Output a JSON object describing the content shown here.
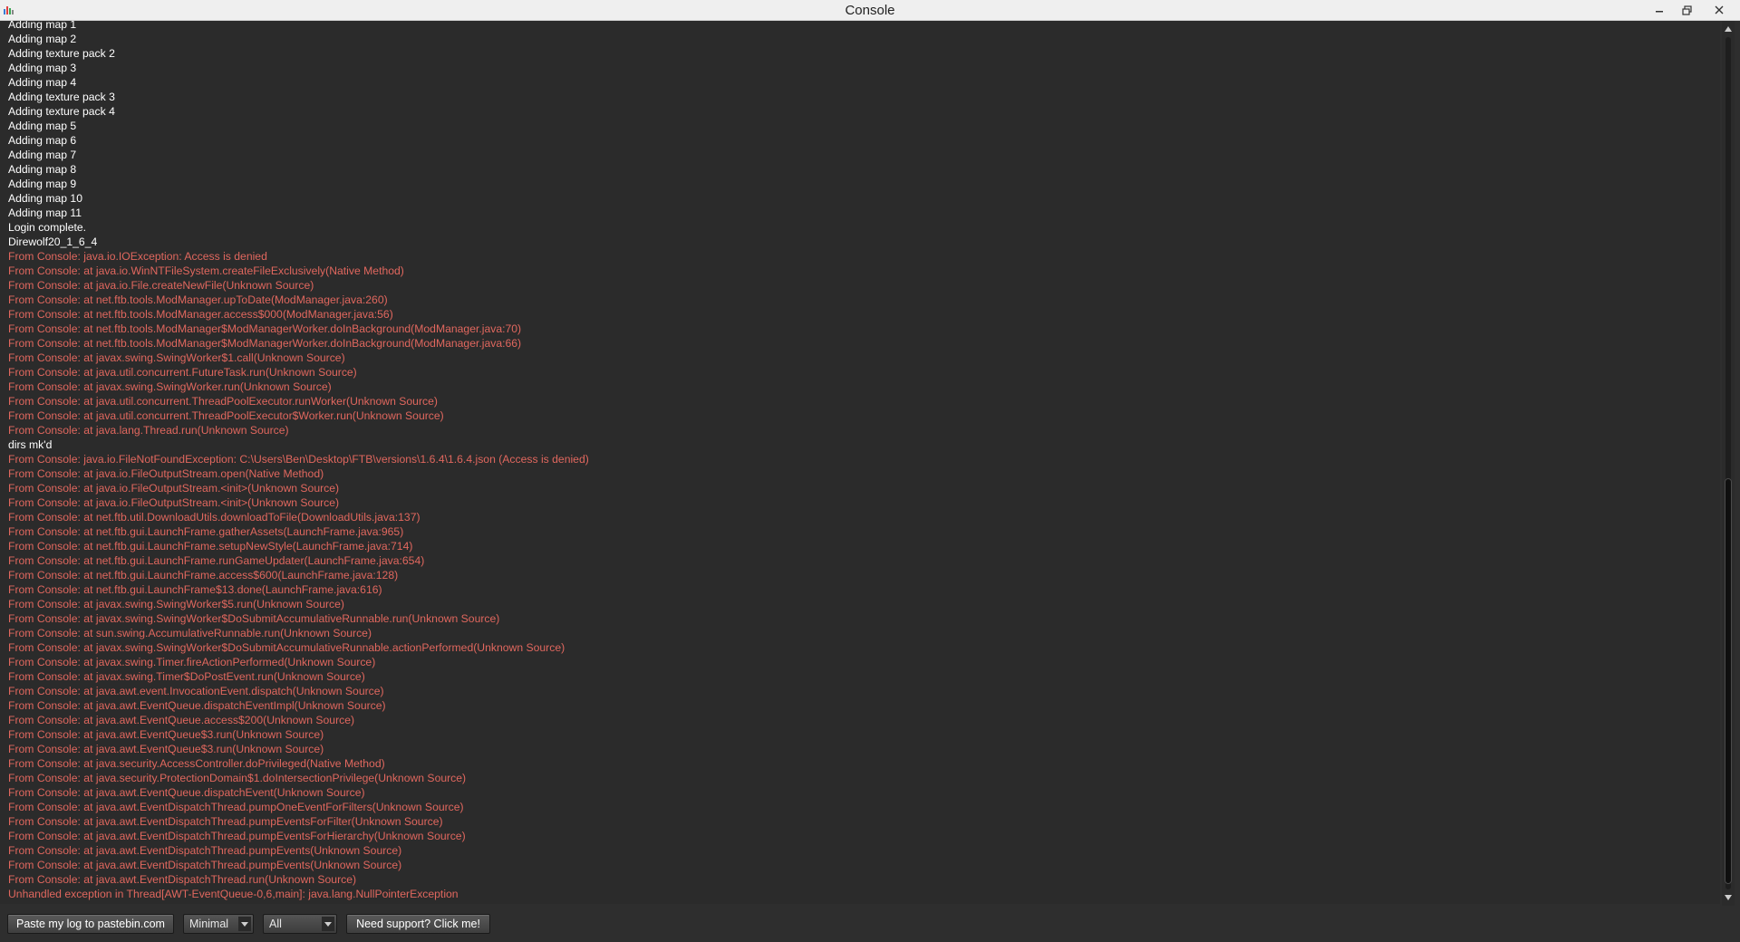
{
  "window": {
    "title": "Console",
    "colors": {
      "info": "#ffffff",
      "error": "#e0675e",
      "background": "#2b2b2b"
    }
  },
  "log": [
    {
      "text": "Adding map 1",
      "level": "info"
    },
    {
      "text": "Adding map 2",
      "level": "info"
    },
    {
      "text": "Adding texture pack 2",
      "level": "info"
    },
    {
      "text": "Adding map 3",
      "level": "info"
    },
    {
      "text": "Adding map 4",
      "level": "info"
    },
    {
      "text": "Adding texture pack 3",
      "level": "info"
    },
    {
      "text": "Adding texture pack 4",
      "level": "info"
    },
    {
      "text": "Adding map 5",
      "level": "info"
    },
    {
      "text": "Adding map 6",
      "level": "info"
    },
    {
      "text": "Adding map 7",
      "level": "info"
    },
    {
      "text": "Adding map 8",
      "level": "info"
    },
    {
      "text": "Adding map 9",
      "level": "info"
    },
    {
      "text": "Adding map 10",
      "level": "info"
    },
    {
      "text": "Adding map 11",
      "level": "info"
    },
    {
      "text": "Login complete.",
      "level": "info"
    },
    {
      "text": "Direwolf20_1_6_4",
      "level": "info"
    },
    {
      "text": "From Console: java.io.IOException: Access is denied",
      "level": "error"
    },
    {
      "text": "From Console: at java.io.WinNTFileSystem.createFileExclusively(Native Method)",
      "level": "error"
    },
    {
      "text": "From Console: at java.io.File.createNewFile(Unknown Source)",
      "level": "error"
    },
    {
      "text": "From Console: at net.ftb.tools.ModManager.upToDate(ModManager.java:260)",
      "level": "error"
    },
    {
      "text": "From Console: at net.ftb.tools.ModManager.access$000(ModManager.java:56)",
      "level": "error"
    },
    {
      "text": "From Console: at net.ftb.tools.ModManager$ModManagerWorker.doInBackground(ModManager.java:70)",
      "level": "error"
    },
    {
      "text": "From Console: at net.ftb.tools.ModManager$ModManagerWorker.doInBackground(ModManager.java:66)",
      "level": "error"
    },
    {
      "text": "From Console: at javax.swing.SwingWorker$1.call(Unknown Source)",
      "level": "error"
    },
    {
      "text": "From Console: at java.util.concurrent.FutureTask.run(Unknown Source)",
      "level": "error"
    },
    {
      "text": "From Console: at javax.swing.SwingWorker.run(Unknown Source)",
      "level": "error"
    },
    {
      "text": "From Console: at java.util.concurrent.ThreadPoolExecutor.runWorker(Unknown Source)",
      "level": "error"
    },
    {
      "text": "From Console: at java.util.concurrent.ThreadPoolExecutor$Worker.run(Unknown Source)",
      "level": "error"
    },
    {
      "text": "From Console: at java.lang.Thread.run(Unknown Source)",
      "level": "error"
    },
    {
      "text": "dirs mk'd",
      "level": "info"
    },
    {
      "text": "From Console: java.io.FileNotFoundException: C:\\Users\\Ben\\Desktop\\FTB\\versions\\1.6.4\\1.6.4.json (Access is denied)",
      "level": "error"
    },
    {
      "text": "From Console: at java.io.FileOutputStream.open(Native Method)",
      "level": "error"
    },
    {
      "text": "From Console: at java.io.FileOutputStream.<init>(Unknown Source)",
      "level": "error"
    },
    {
      "text": "From Console: at java.io.FileOutputStream.<init>(Unknown Source)",
      "level": "error"
    },
    {
      "text": "From Console: at net.ftb.util.DownloadUtils.downloadToFile(DownloadUtils.java:137)",
      "level": "error"
    },
    {
      "text": "From Console: at net.ftb.gui.LaunchFrame.gatherAssets(LaunchFrame.java:965)",
      "level": "error"
    },
    {
      "text": "From Console: at net.ftb.gui.LaunchFrame.setupNewStyle(LaunchFrame.java:714)",
      "level": "error"
    },
    {
      "text": "From Console: at net.ftb.gui.LaunchFrame.runGameUpdater(LaunchFrame.java:654)",
      "level": "error"
    },
    {
      "text": "From Console: at net.ftb.gui.LaunchFrame.access$600(LaunchFrame.java:128)",
      "level": "error"
    },
    {
      "text": "From Console: at net.ftb.gui.LaunchFrame$13.done(LaunchFrame.java:616)",
      "level": "error"
    },
    {
      "text": "From Console: at javax.swing.SwingWorker$5.run(Unknown Source)",
      "level": "error"
    },
    {
      "text": "From Console: at javax.swing.SwingWorker$DoSubmitAccumulativeRunnable.run(Unknown Source)",
      "level": "error"
    },
    {
      "text": "From Console: at sun.swing.AccumulativeRunnable.run(Unknown Source)",
      "level": "error"
    },
    {
      "text": "From Console: at javax.swing.SwingWorker$DoSubmitAccumulativeRunnable.actionPerformed(Unknown Source)",
      "level": "error"
    },
    {
      "text": "From Console: at javax.swing.Timer.fireActionPerformed(Unknown Source)",
      "level": "error"
    },
    {
      "text": "From Console: at javax.swing.Timer$DoPostEvent.run(Unknown Source)",
      "level": "error"
    },
    {
      "text": "From Console: at java.awt.event.InvocationEvent.dispatch(Unknown Source)",
      "level": "error"
    },
    {
      "text": "From Console: at java.awt.EventQueue.dispatchEventImpl(Unknown Source)",
      "level": "error"
    },
    {
      "text": "From Console: at java.awt.EventQueue.access$200(Unknown Source)",
      "level": "error"
    },
    {
      "text": "From Console: at java.awt.EventQueue$3.run(Unknown Source)",
      "level": "error"
    },
    {
      "text": "From Console: at java.awt.EventQueue$3.run(Unknown Source)",
      "level": "error"
    },
    {
      "text": "From Console: at java.security.AccessController.doPrivileged(Native Method)",
      "level": "error"
    },
    {
      "text": "From Console: at java.security.ProtectionDomain$1.doIntersectionPrivilege(Unknown Source)",
      "level": "error"
    },
    {
      "text": "From Console: at java.awt.EventQueue.dispatchEvent(Unknown Source)",
      "level": "error"
    },
    {
      "text": "From Console: at java.awt.EventDispatchThread.pumpOneEventForFilters(Unknown Source)",
      "level": "error"
    },
    {
      "text": "From Console: at java.awt.EventDispatchThread.pumpEventsForFilter(Unknown Source)",
      "level": "error"
    },
    {
      "text": "From Console: at java.awt.EventDispatchThread.pumpEventsForHierarchy(Unknown Source)",
      "level": "error"
    },
    {
      "text": "From Console: at java.awt.EventDispatchThread.pumpEvents(Unknown Source)",
      "level": "error"
    },
    {
      "text": "From Console: at java.awt.EventDispatchThread.pumpEvents(Unknown Source)",
      "level": "error"
    },
    {
      "text": "From Console: at java.awt.EventDispatchThread.run(Unknown Source)",
      "level": "error"
    },
    {
      "text": "Unhandled exception in Thread[AWT-EventQueue-0,6,main]: java.lang.NullPointerException",
      "level": "error"
    }
  ],
  "toolbar": {
    "paste_label": "Paste my log to pastebin.com",
    "log_type_value": "Minimal",
    "log_source_value": "All",
    "support_label": "Need support? Click me!"
  },
  "icons": {
    "app": "app-icon",
    "minimize": "minimize-icon",
    "restore": "restore-icon",
    "close": "close-icon",
    "dropdown": "chevron-down-icon"
  }
}
